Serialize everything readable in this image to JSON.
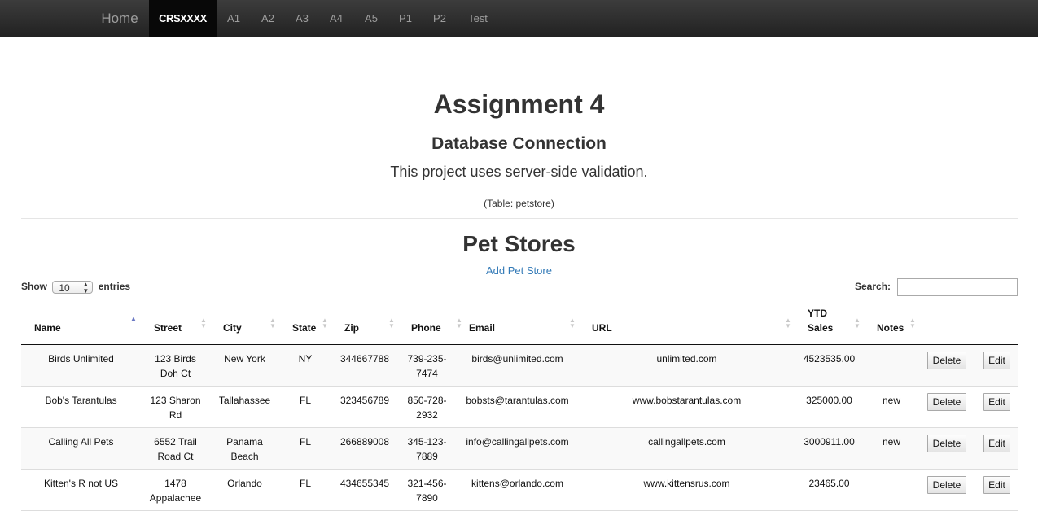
{
  "nav": {
    "brand": "Home",
    "active": "CRSXXXX",
    "items": [
      "A1",
      "A2",
      "A3",
      "A4",
      "A5",
      "P1",
      "P2",
      "Test"
    ]
  },
  "header": {
    "title": "Assignment 4",
    "subtitle": "Database Connection",
    "description": "This project uses server-side validation.",
    "table_note": "(Table: petstore)"
  },
  "section": {
    "title": "Pet Stores",
    "add_link": "Add Pet Store"
  },
  "controls": {
    "show_label": "Show",
    "entries_value": "10",
    "entries_label": "entries",
    "search_label": "Search:",
    "search_value": ""
  },
  "table": {
    "columns": {
      "name": "Name",
      "street": "Street",
      "city": "City",
      "state": "State",
      "zip": "Zip",
      "phone": "Phone",
      "email": "Email",
      "url": "URL",
      "ytd_line1": "YTD",
      "ytd_line2": "Sales",
      "notes": "Notes"
    },
    "delete_label": "Delete",
    "edit_label": "Edit",
    "rows": [
      {
        "name": "Birds Unlimited",
        "street1": "123 Birds",
        "street2": "Doh Ct",
        "city1": "New York",
        "city2": "",
        "state": "NY",
        "zip": "344667788",
        "phone1": "739-235-",
        "phone2": "7474",
        "email": "birds@unlimited.com",
        "url": "unlimited.com",
        "ytd": "4523535.00",
        "notes": ""
      },
      {
        "name": "Bob's Tarantulas",
        "street1": "123 Sharon",
        "street2": "Rd",
        "city1": "Tallahassee",
        "city2": "",
        "state": "FL",
        "zip": "323456789",
        "phone1": "850-728-",
        "phone2": "2932",
        "email": "bobsts@tarantulas.com",
        "url": "www.bobstarantulas.com",
        "ytd": "325000.00",
        "notes": "new"
      },
      {
        "name": "Calling All Pets",
        "street1": "6552 Trail",
        "street2": "Road Ct",
        "city1": "Panama",
        "city2": "Beach",
        "state": "FL",
        "zip": "266889008",
        "phone1": "345-123-",
        "phone2": "7889",
        "email": "info@callingallpets.com",
        "url": "callingallpets.com",
        "ytd": "3000911.00",
        "notes": "new"
      },
      {
        "name": "Kitten's R not US",
        "street1": "1478",
        "street2": "Appalachee",
        "city1": "Orlando",
        "city2": "",
        "state": "FL",
        "zip": "434655345",
        "phone1": "321-456-",
        "phone2": "7890",
        "email": "kittens@orlando.com",
        "url": "www.kittensrus.com",
        "ytd": "23465.00",
        "notes": ""
      }
    ]
  }
}
